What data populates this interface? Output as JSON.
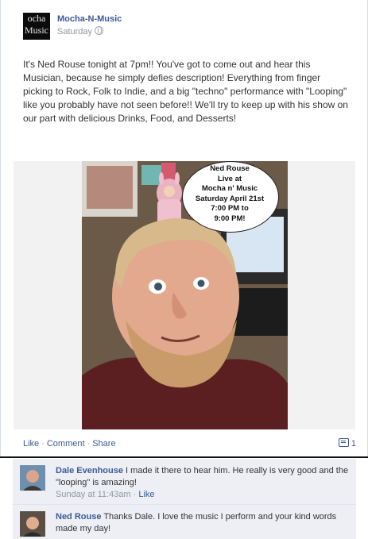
{
  "post": {
    "page_name": "Mocha-N-Music",
    "avatar_text": [
      "ocha",
      "Music"
    ],
    "time": "Saturday",
    "text": "It's Ned Rouse tonight at 7pm!! You've got to come out and hear this Musician, because he simply defies description! Everything from finger picking to Rock, Folk to Indie, and a big \"techno\" performance with \"Looping\" like you probably have not seen before!! We'll try to keep up with his show on our part with delicious Drinks, Food, and Desserts!",
    "photo": {
      "bubble_lines": [
        "Ned Rouse",
        "Live at",
        "Mocha n' Music",
        "Saturday April 21st",
        "7:00 PM to",
        "9:00 PM!"
      ]
    },
    "actions": {
      "like": "Like",
      "comment": "Comment",
      "share": "Share",
      "separator": "·"
    },
    "comment_count": "1"
  },
  "comments": [
    {
      "author": "Dale Evenhouse",
      "text": "I made it there to hear him. He really is very good and the \"looping\" is amazing!",
      "time": "Sunday at 11:43am",
      "like": "Like"
    },
    {
      "author": "Ned Rouse",
      "text": "Thanks Dale. I love the music I perform and your kind words made my day!"
    }
  ],
  "colors": {
    "link": "#3b5998",
    "meta": "#9197a3",
    "comment_bg": "#edeff4"
  },
  "icons": [
    "globe-icon",
    "comment-icon"
  ]
}
